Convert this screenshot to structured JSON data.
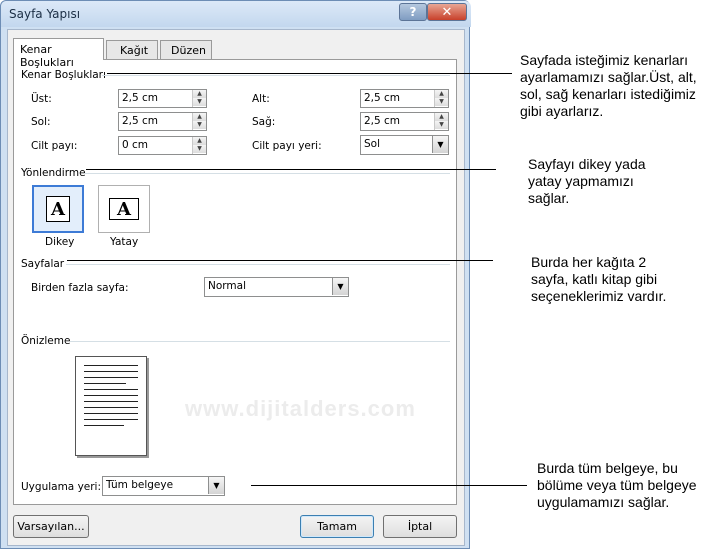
{
  "window": {
    "title": "Sayfa Yapısı",
    "help_label": "?",
    "close_label": "✕"
  },
  "tabs": [
    {
      "label": "Kenar Boşlukları"
    },
    {
      "label": "Kağıt"
    },
    {
      "label": "Düzen"
    }
  ],
  "margins": {
    "section_title": "Kenar Boşlukları",
    "top_label": "Üst:",
    "top_value": "2,5 cm",
    "bottom_label": "Alt:",
    "bottom_value": "2,5 cm",
    "left_label": "Sol:",
    "left_value": "2,5 cm",
    "right_label": "Sağ:",
    "right_value": "2,5 cm",
    "gutter_label": "Cilt payı:",
    "gutter_value": "0 cm",
    "gutter_pos_label": "Cilt payı yeri:",
    "gutter_pos_value": "Sol"
  },
  "orientation": {
    "section_title": "Yönlendirme",
    "portrait_label": "Dikey",
    "landscape_label": "Yatay",
    "icon_glyph": "A",
    "selected": "portrait"
  },
  "pages": {
    "section_title": "Sayfalar",
    "multiple_label": "Birden fazla sayfa:",
    "multiple_value": "Normal"
  },
  "preview": {
    "section_title": "Önizleme"
  },
  "apply": {
    "label": "Uygulama yeri:",
    "value": "Tüm belgeye"
  },
  "buttons": {
    "default_label": "Varsayılan...",
    "ok_label": "Tamam",
    "cancel_label": "İptal"
  },
  "watermark": "www.dijitalders.com",
  "annotations": [
    {
      "text": "Sayfada isteğimiz kenarları ayarlamamızı sağlar.Üst, alt, sol, sağ kenarları istediğimiz gibi ayarlarız."
    },
    {
      "text": "Sayfayı dikey yada yatay yapmamızı sağlar."
    },
    {
      "text": "Burda her kağıta 2 sayfa, katlı kitap gibi seçeneklerimiz vardır."
    },
    {
      "text": "Burda tüm belgeye, bu bölüme veya tüm belgeye uygulamamızı sağlar."
    }
  ],
  "colors": {
    "title_bar": "#c3d7ee",
    "close_button": "#c8402a",
    "selected_orientation": "#3d7bd6"
  }
}
